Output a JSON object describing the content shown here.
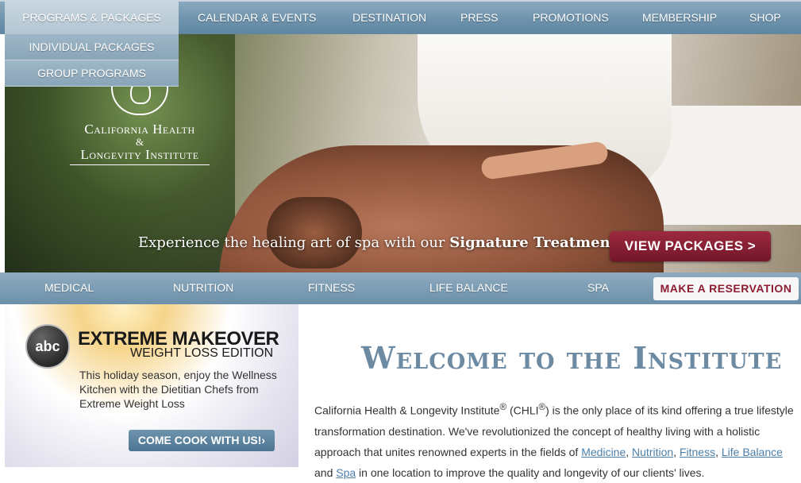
{
  "top_nav": {
    "items": [
      "PROGRAMS & PACKAGES",
      "CALENDAR & EVENTS",
      "DESTINATION",
      "PRESS",
      "PROMOTIONS",
      "MEMBERSHIP",
      "SHOP"
    ],
    "dropdown": [
      "INDIVIDUAL PACKAGES",
      "GROUP PROGRAMS"
    ]
  },
  "logo": {
    "line1": "California Health",
    "line2": "&",
    "line3": "Longevity Institute"
  },
  "hero": {
    "tagline_prefix": "Experience the healing art of spa with our ",
    "tagline_bold": "Signature Treatments",
    "cta": "VIEW PACKAGES >"
  },
  "secondary_nav": {
    "items": [
      "MEDICAL",
      "NUTRITION",
      "FITNESS",
      "LIFE BALANCE",
      "SPA"
    ],
    "reserve": "MAKE A RESERVATION"
  },
  "promo": {
    "network": "abc",
    "title": "EXTREME MAKEOVER",
    "subtitle": "WEIGHT LOSS EDITION",
    "text": "This holiday season, enjoy the Wellness Kitchen with the Dietitian Chefs from Extreme Weight Loss",
    "button": "COME COOK WITH US!›"
  },
  "welcome": {
    "heading": "Welcome to the Institute",
    "p1": "California Health & Longevity Institute",
    "reg": "®",
    "p2": " (CHLI",
    "p3": ") is the only place of its kind offering a true lifestyle transformation destination. We've revolutionized the concept of healthy living with a holistic approach that unites renowned experts in the fields of ",
    "links": [
      "Medicine",
      "Nutrition",
      "Fitness",
      "Life Balance",
      "Spa"
    ],
    "sep1": ", ",
    "and": " and ",
    "p4": " in one location to improve the quality and longevity of our clients' lives."
  },
  "colors": {
    "nav": "#6f93ad",
    "accent": "#8c1c31",
    "heading": "#6d8aa3"
  }
}
